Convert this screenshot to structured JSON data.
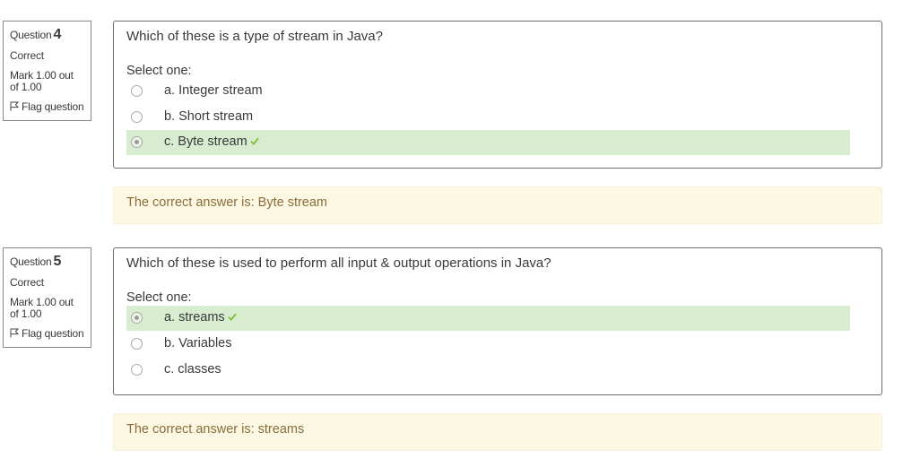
{
  "questions": [
    {
      "label": "Question",
      "number": "4",
      "state": "Correct",
      "grade": "Mark 1.00 out of 1.00",
      "flag_label": "Flag question",
      "text": "Which of these is a type of stream in Java?",
      "prompt": "Select one:",
      "answers": [
        {
          "label": "a. Integer stream",
          "selected": false,
          "correct": false
        },
        {
          "label": "b. Short stream",
          "selected": false,
          "correct": false
        },
        {
          "label": "c. Byte stream",
          "selected": true,
          "correct": true
        }
      ],
      "feedback": "The correct answer is: Byte stream"
    },
    {
      "label": "Question",
      "number": "5",
      "state": "Correct",
      "grade": "Mark 1.00 out of 1.00",
      "flag_label": "Flag question",
      "text": "Which of these is used to perform all input & output operations in Java?",
      "prompt": "Select one:",
      "answers": [
        {
          "label": "a. streams",
          "selected": true,
          "correct": true
        },
        {
          "label": "b. Variables",
          "selected": false,
          "correct": false
        },
        {
          "label": "c. classes",
          "selected": false,
          "correct": false
        }
      ],
      "feedback": "The correct answer is: streams"
    }
  ],
  "icons": {
    "flag": "flag-icon",
    "correct": "checkmark-icon"
  },
  "colors": {
    "correct_bg": "#d8ecd0",
    "feedback_bg": "#fcf8e3",
    "feedback_text": "#8a6d3b",
    "check": "#7cbf3a"
  }
}
